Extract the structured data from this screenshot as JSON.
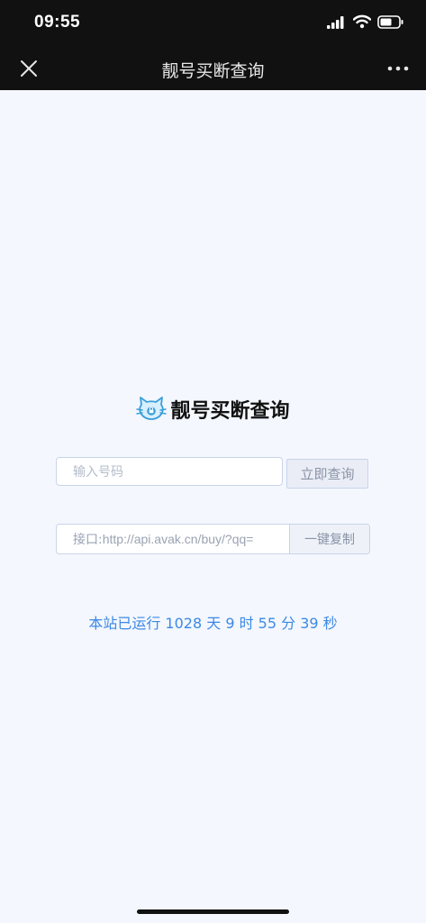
{
  "status_bar": {
    "time": "09:55"
  },
  "nav": {
    "title": "靓号买断查询",
    "close_icon": "close-icon",
    "more_icon": "more-icon"
  },
  "main": {
    "brand_title": "靓号买断查询",
    "search": {
      "placeholder": "输入号码",
      "value": ""
    },
    "query_button": "立即查询",
    "api": {
      "prefix": "接口:",
      "url": "http://api.avak.cn/buy/?qq="
    },
    "copy_button": "一键复制",
    "uptime": "本站已运行 1028 天 9 时 55 分 39 秒"
  },
  "colors": {
    "bar_background": "#111111",
    "page_background": "#f4f7fd",
    "accent_text": "#3c89e6",
    "logo_color": "#3a9fd8"
  }
}
